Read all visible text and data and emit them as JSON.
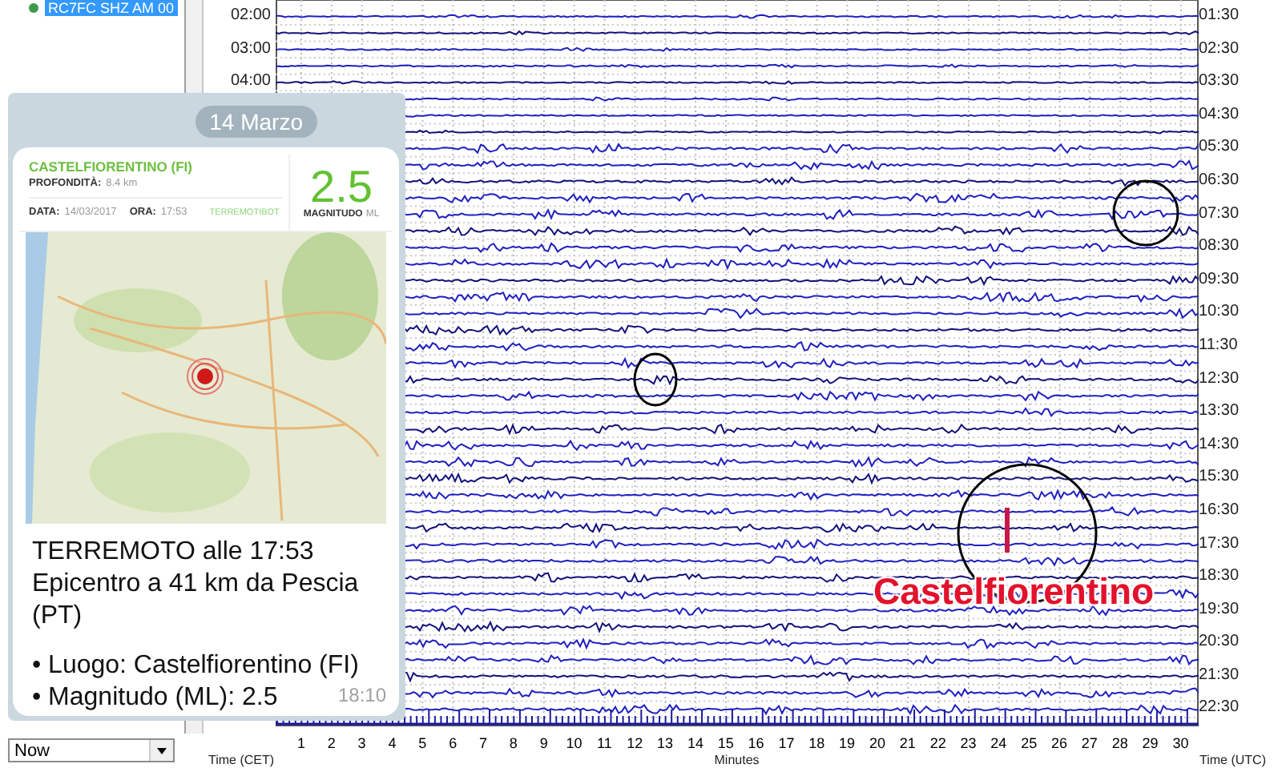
{
  "tree": {
    "items": [
      {
        "label": "RC7FC SHZ AM 00",
        "selected": true
      }
    ]
  },
  "helicorder": {
    "left_labels": [
      "02:00",
      "03:00",
      "04:00"
    ],
    "right_labels": [
      "01:30",
      "02:30",
      "03:30",
      "04:30",
      "05:30",
      "06:30",
      "07:30",
      "08:30",
      "09:30",
      "10:30",
      "11:30",
      "12:30",
      "13:30",
      "14:30",
      "15:30",
      "16:30",
      "17:30",
      "18:30",
      "19:30",
      "20:30",
      "21:30",
      "22:30"
    ],
    "minute_ticks": [
      "1",
      "2",
      "3",
      "4",
      "5",
      "6",
      "7",
      "8",
      "9",
      "10",
      "11",
      "12",
      "13",
      "14",
      "15",
      "16",
      "17",
      "18",
      "19",
      "20",
      "21",
      "22",
      "23",
      "24",
      "25",
      "26",
      "27",
      "28",
      "29",
      "30"
    ],
    "annotation": "Castelfiorentino",
    "left_axis_label": "Time (CET)",
    "x_axis_label": "Minutes",
    "right_axis_label": "Time (UTC)"
  },
  "range_dropdown": {
    "value": "Now"
  },
  "message_card": {
    "date": "14 Marzo",
    "quake": {
      "place": "CASTELFIORENTINO (FI)",
      "depth_label": "PROFONDITÀ:",
      "depth": "8.4 km",
      "date_label": "DATA:",
      "date": "14/03/2017",
      "time_label": "ORA:",
      "time": "17:53",
      "source": "TERREMOTIBOT",
      "magnitude": "2.5",
      "magnitude_label": "MAGNITUDO",
      "magnitude_unit": "ML"
    },
    "paragraphs": [
      [
        "TERREMOTO alle 17:53",
        "Epicentro a 41 km da Pescia (PT)"
      ],
      [
        "• Luogo: Castelfiorentino (FI)",
        "• Magnitudo (ML): 2.5"
      ]
    ],
    "sent_time": "18:10"
  }
}
